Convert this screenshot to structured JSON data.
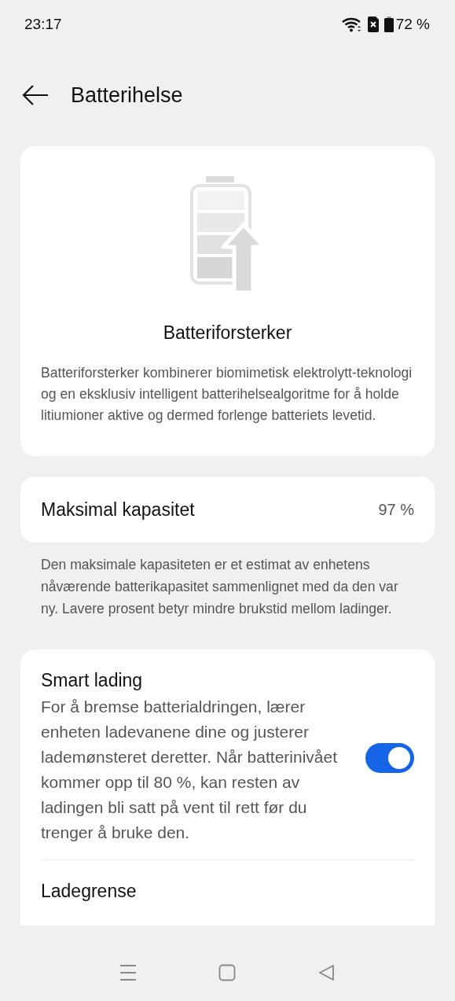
{
  "status_bar": {
    "time": "23:17",
    "battery_text": "72 %"
  },
  "header": {
    "title": "Batterihelse"
  },
  "booster_card": {
    "title": "Batteriforsterker",
    "description": "Batteriforsterker kombinerer biomimetisk elektrolytt-teknologi og en eksklusiv intelligent batterihelsealgoritme for å holde litiumioner aktive og dermed forlenge batteriets levetid."
  },
  "capacity": {
    "label": "Maksimal kapasitet",
    "value": "97 %",
    "note": "Den maksimale kapasiteten er et estimat av enhetens nåværende batterikapasitet sammenlignet med da den var ny. Lavere prosent betyr mindre brukstid mellom ladinger."
  },
  "settings": [
    {
      "kind": "toggle",
      "title": "Smart lading",
      "description": "For å bremse batterialdringen, lærer enheten ladevanene dine og justerer lademønsteret deretter. Når batterinivået kommer opp til 80 %, kan resten av ladingen bli satt på vent til rett før du trenger å bruke den.",
      "on": true
    },
    {
      "kind": "link",
      "title": "Ladegrense"
    }
  ]
}
